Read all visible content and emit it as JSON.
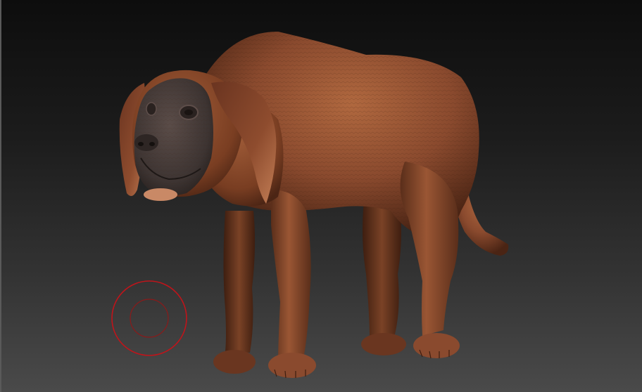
{
  "viewport": {
    "background_top": "#0d0d0d",
    "background_bottom": "#4a4a4a"
  },
  "model": {
    "subject": "dog-sculpt",
    "material_color": "#8a4a2e",
    "material_dark": "#4a2414",
    "material_light": "#b9724c",
    "face_color": "#3d3432"
  },
  "brush_cursor": {
    "outer_color": "#c0141a",
    "inner_color": "#8a1a1a"
  }
}
